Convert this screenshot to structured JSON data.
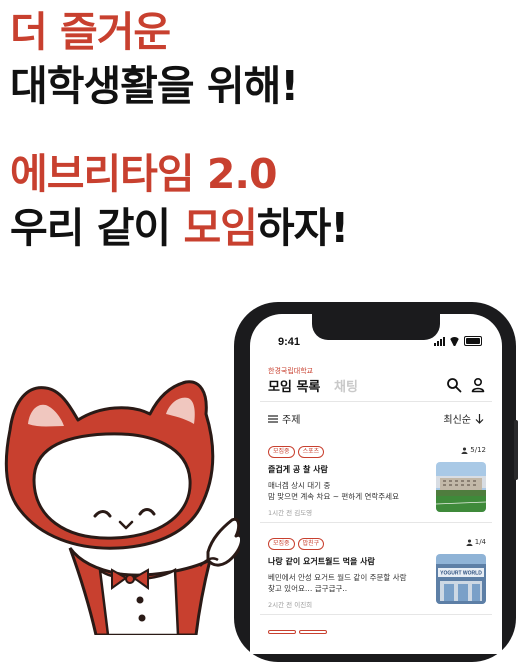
{
  "headline": {
    "line1": "더 즐거운",
    "line2": "대학생활을 위해!",
    "line3": "에브리타임 2.0",
    "line4_pre": "우리 같이 ",
    "line4_accent": "모임",
    "line4_post": "하자!"
  },
  "colors": {
    "accent": "#c8402f",
    "text": "#111111"
  },
  "app": {
    "status_time": "9:41",
    "school": "한경국립대학교",
    "title": "모임 목록",
    "tab_chat": "채팅",
    "filter_label": "주제",
    "sort_label": "최신순",
    "items": [
      {
        "tags": [
          "모집중",
          "스포츠"
        ],
        "count": "5/12",
        "title": "즐겁게 공 찰 사람",
        "body": "매너겜 상시 대기 중\n맘 맞으면 계속 차요 ~ 편하게 연락주세요",
        "meta": "1시간 전  김도영"
      },
      {
        "tags": [
          "모집중",
          "밥친구"
        ],
        "count": "1/4",
        "title": "나랑 같이 요거트월드 먹을 사람",
        "body": "베민에서 안성 요거트 월드 같이 주문할 사람\n찾고 있어요… 급구급구..",
        "meta": "2시간 전  이진희"
      }
    ],
    "thumb2_sign": "YOGURT WORLD"
  }
}
